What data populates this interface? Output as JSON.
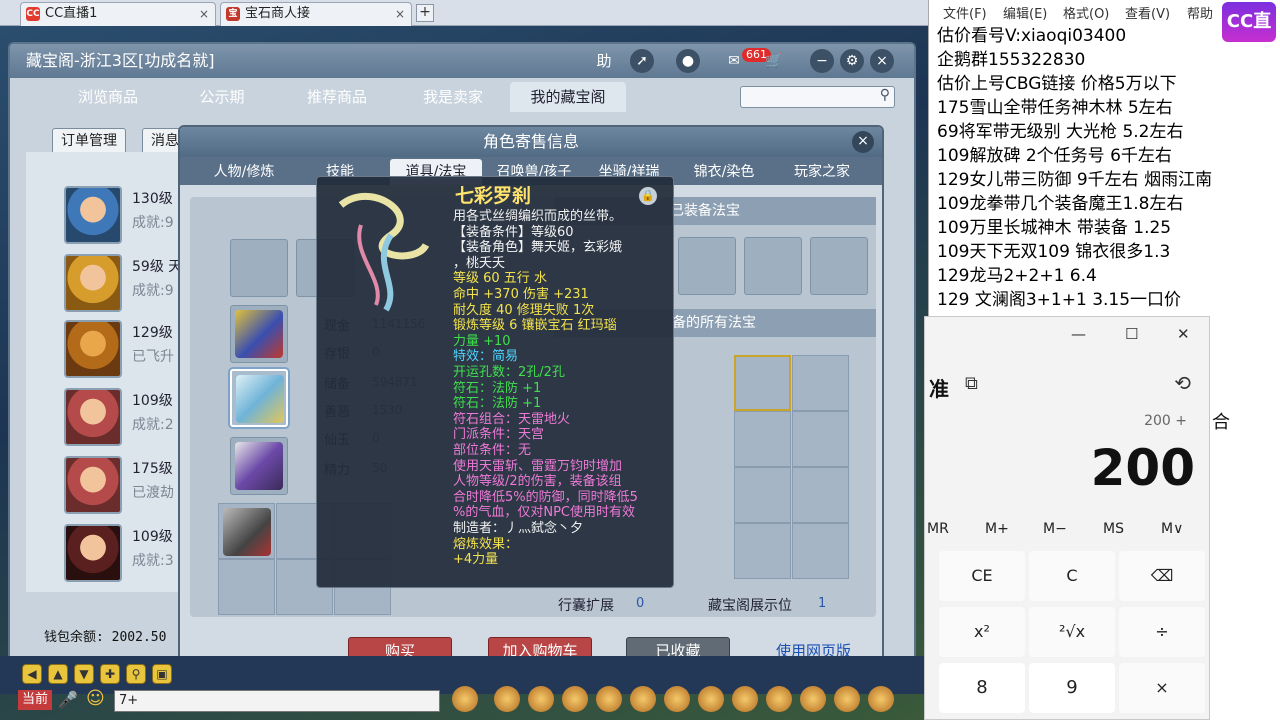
{
  "browser": {
    "tabs": [
      {
        "label": "CC直播1",
        "icon": "cc-icon"
      },
      {
        "label": "宝石商人接",
        "icon": "game-icon"
      }
    ],
    "new_tab": "+"
  },
  "cbg": {
    "title": "藏宝阁-浙江3区[功成名就]",
    "help": "助",
    "message_count": "661",
    "nav": [
      "浏览商品",
      "公示期",
      "推荐商品",
      "我是卖家",
      "我的藏宝阁"
    ],
    "sub_buttons": [
      "订单管理",
      "消息提醒"
    ],
    "characters": [
      {
        "level": "130级",
        "sub": "成就:9"
      },
      {
        "level": "59级 天",
        "sub": "成就:9"
      },
      {
        "level": "129级",
        "sub": "已飞升"
      },
      {
        "level": "109级",
        "sub": "成就:2"
      },
      {
        "level": "175级",
        "sub": "已渡劫"
      },
      {
        "level": "109级",
        "sub": "成就:3"
      }
    ],
    "wallet": "钱包余额: 2002.50"
  },
  "dialog": {
    "title": "角色寄售信息",
    "close": "×",
    "tabs": [
      "人物/修炼",
      "技能",
      "道具/法宝",
      "召唤兽/孩子",
      "坐骑/祥瑞",
      "锦衣/染色",
      "玩家之家"
    ],
    "equipped_treasure_header": "已装备法宝",
    "all_treasure_header": "备的所有法宝",
    "stats": [
      {
        "label": "现金",
        "value": "1141156"
      },
      {
        "label": "存银",
        "value": "0"
      },
      {
        "label": "储备",
        "value": "594871"
      },
      {
        "label": "善恶",
        "value": "1530"
      },
      {
        "label": "仙玉",
        "value": "0"
      },
      {
        "label": "精力",
        "value": "50"
      }
    ],
    "footer": [
      {
        "label": "行囊扩展",
        "value": "0"
      },
      {
        "label": "藏宝阁展示位",
        "value": "1"
      }
    ],
    "buttons": {
      "buy": "购买",
      "cart": "加入购物车",
      "fav": "已收藏",
      "web": "使用网页版"
    }
  },
  "tooltip": {
    "name": "七彩罗刹",
    "lock": "🔒",
    "lines": [
      {
        "text": "用各式丝绸编织而成的丝带。",
        "color": "white"
      },
      {
        "text": "【装备条件】等级60",
        "color": "white"
      },
      {
        "text": "【装备角色】舞天姬，玄彩娥",
        "color": "white"
      },
      {
        "text": "，桃夭夭",
        "color": "white"
      },
      {
        "text": "等级 60   五行 水",
        "color": "yellow"
      },
      {
        "text": "命中 +370 伤害 +231",
        "color": "yellow"
      },
      {
        "text": "耐久度 40   修理失败 1次",
        "color": "yellow"
      },
      {
        "text": "锻炼等级 6   镶嵌宝石 红玛瑙",
        "color": "yellow"
      },
      {
        "text": "力量 +10",
        "color": "green"
      },
      {
        "text": "特效：简易",
        "color": "cyan"
      },
      {
        "text": "开运孔数：2孔/2孔",
        "color": "green"
      },
      {
        "text": "符石：法防 +1",
        "color": "green"
      },
      {
        "text": "符石：法防 +1",
        "color": "green"
      },
      {
        "text": "符石组合：天雷地火",
        "color": "pink"
      },
      {
        "text": "门派条件：天宫",
        "color": "pink"
      },
      {
        "text": "部位条件：无",
        "color": "pink"
      },
      {
        "text": "使用天雷斩、雷霆万钧时增加",
        "color": "pink"
      },
      {
        "text": "人物等级/2的伤害，装备该组",
        "color": "pink"
      },
      {
        "text": "合时降低5%的防御，同时降低5",
        "color": "pink"
      },
      {
        "text": "%的气血，仅对NPC使用时有效",
        "color": "pink"
      },
      {
        "text": "制造者：丿灬弑念丶夕",
        "color": "white"
      },
      {
        "text": "熔炼效果：",
        "color": "yellow"
      },
      {
        "text": "+4力量",
        "color": "yellow"
      }
    ]
  },
  "chat": {
    "channel": "当前",
    "input": "7+"
  },
  "notepad": {
    "menu": [
      "文件(F)",
      "编辑(E)",
      "格式(O)",
      "查看(V)",
      "帮助"
    ],
    "brand": "CC直播",
    "lines": [
      "估价看号V:xiaoqi03400",
      "企鹅群155322830",
      "估价上号CBG链接   价格5万以下",
      "175雪山全带任务神木林 5左右",
      "69将军带无级别 大光枪 5.2左右",
      "109解放碑 2个任务号 6千左右",
      "129女儿带三防御 9千左右 烟雨江南",
      "109龙拳带几个装备魔王1.8左右",
      "109万里长城神木 带装备  1.25",
      "109天下无双109  锦衣很多1.3",
      "129龙马2+2+1  6.4",
      "129 文澜阁3+1+1   3.15一口价"
    ]
  },
  "calculator": {
    "mode": "准",
    "expression": "200 +",
    "display": "200",
    "memory": [
      "MR",
      "M+",
      "M−",
      "MS",
      "M∨"
    ],
    "keys": [
      [
        "CE",
        "C",
        "⌫"
      ],
      [
        "x²",
        "²√x",
        "÷"
      ],
      [
        "8",
        "9",
        "×"
      ]
    ],
    "edge_char": "合"
  }
}
